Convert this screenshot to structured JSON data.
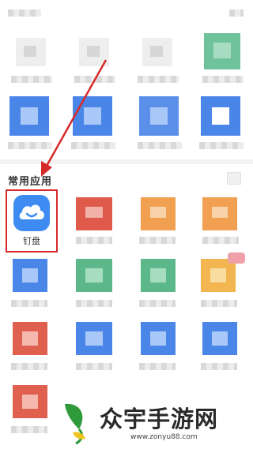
{
  "section": {
    "title": "常用应用"
  },
  "featured_app": {
    "label": "钉盘",
    "icon": "cloud-smile-icon",
    "color": "#3e8cf2"
  },
  "highlight_color": "#d62a2a",
  "watermark": {
    "brand": "众宇手游网",
    "url": "www.zonyu88.com"
  },
  "tile_colors": {
    "blue": "#4a86e8",
    "red": "#e06050",
    "orange": "#f0a050",
    "green": "#5cb88a",
    "gray": "#cfcfcf"
  }
}
